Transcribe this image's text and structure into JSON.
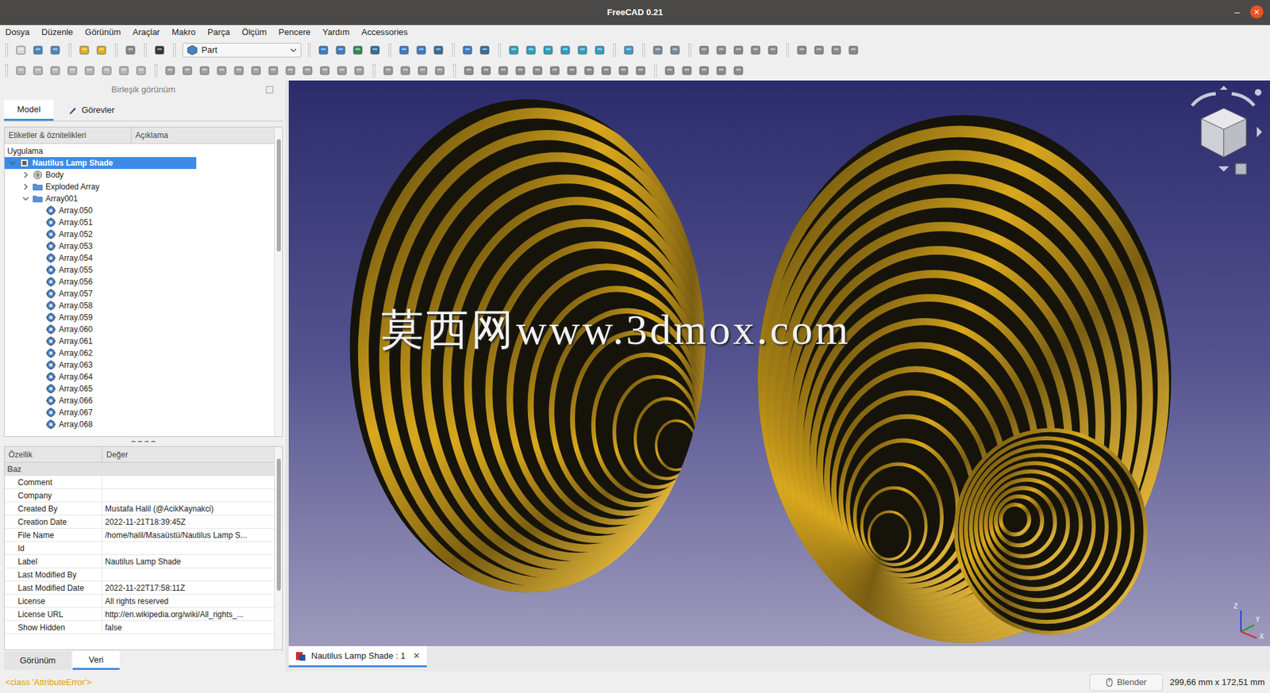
{
  "window": {
    "title": "FreeCAD 0.21",
    "minimize": "–",
    "close": "×"
  },
  "menu": [
    "Dosya",
    "Düzenle",
    "Görünüm",
    "Araçlar",
    "Makro",
    "Parça",
    "Ölçüm",
    "Pencere",
    "Yardım",
    "Accessories"
  ],
  "workbench": {
    "label": "Part"
  },
  "combo_view": {
    "title": "Birleşik görünüm",
    "tabs": [
      {
        "label": "Model",
        "selected": true
      },
      {
        "label": "Görevler",
        "selected": false
      }
    ]
  },
  "tree": {
    "columns": [
      "Etiketler & öznitelikleri",
      "Açıklama"
    ],
    "root": "Uygulama",
    "items": [
      {
        "label": "Nautilus Lamp Shade",
        "kind": "document",
        "depth": 0,
        "has_children": true,
        "expanded": true,
        "selected": true
      },
      {
        "label": "Body",
        "kind": "body",
        "depth": 1,
        "has_children": true,
        "expanded": false,
        "selected": false
      },
      {
        "label": "Exploded Array",
        "kind": "folder",
        "depth": 1,
        "has_children": true,
        "expanded": false,
        "selected": false
      },
      {
        "label": "Array001",
        "kind": "folder",
        "depth": 1,
        "has_children": true,
        "expanded": true,
        "selected": false
      },
      {
        "label": "Array.050",
        "kind": "array",
        "depth": 2,
        "has_children": false,
        "expanded": false,
        "selected": false
      },
      {
        "label": "Array.051",
        "kind": "array",
        "depth": 2,
        "has_children": false,
        "expanded": false,
        "selected": false
      },
      {
        "label": "Array.052",
        "kind": "array",
        "depth": 2,
        "has_children": false,
        "expanded": false,
        "selected": false
      },
      {
        "label": "Array.053",
        "kind": "array",
        "depth": 2,
        "has_children": false,
        "expanded": false,
        "selected": false
      },
      {
        "label": "Array.054",
        "kind": "array",
        "depth": 2,
        "has_children": false,
        "expanded": false,
        "selected": false
      },
      {
        "label": "Array.055",
        "kind": "array",
        "depth": 2,
        "has_children": false,
        "expanded": false,
        "selected": false
      },
      {
        "label": "Array.056",
        "kind": "array",
        "depth": 2,
        "has_children": false,
        "expanded": false,
        "selected": false
      },
      {
        "label": "Array.057",
        "kind": "array",
        "depth": 2,
        "has_children": false,
        "expanded": false,
        "selected": false
      },
      {
        "label": "Array.058",
        "kind": "array",
        "depth": 2,
        "has_children": false,
        "expanded": false,
        "selected": false
      },
      {
        "label": "Array.059",
        "kind": "array",
        "depth": 2,
        "has_children": false,
        "expanded": false,
        "selected": false
      },
      {
        "label": "Array.060",
        "kind": "array",
        "depth": 2,
        "has_children": false,
        "expanded": false,
        "selected": false
      },
      {
        "label": "Array.061",
        "kind": "array",
        "depth": 2,
        "has_children": false,
        "expanded": false,
        "selected": false
      },
      {
        "label": "Array.062",
        "kind": "array",
        "depth": 2,
        "has_children": false,
        "expanded": false,
        "selected": false
      },
      {
        "label": "Array.063",
        "kind": "array",
        "depth": 2,
        "has_children": false,
        "expanded": false,
        "selected": false
      },
      {
        "label": "Array.064",
        "kind": "array",
        "depth": 2,
        "has_children": false,
        "expanded": false,
        "selected": false
      },
      {
        "label": "Array.065",
        "kind": "array",
        "depth": 2,
        "has_children": false,
        "expanded": false,
        "selected": false
      },
      {
        "label": "Array.066",
        "kind": "array",
        "depth": 2,
        "has_children": false,
        "expanded": false,
        "selected": false
      },
      {
        "label": "Array.067",
        "kind": "array",
        "depth": 2,
        "has_children": false,
        "expanded": false,
        "selected": false
      },
      {
        "label": "Array.068",
        "kind": "array",
        "depth": 2,
        "has_children": false,
        "expanded": false,
        "selected": false
      }
    ]
  },
  "properties": {
    "columns": [
      "Özellik",
      "Değer"
    ],
    "group": "Baz",
    "rows": [
      {
        "name": "Comment",
        "value": ""
      },
      {
        "name": "Company",
        "value": ""
      },
      {
        "name": "Created By",
        "value": "Mustafa Halil (@AcikKaynakci)"
      },
      {
        "name": "Creation Date",
        "value": "2022-11-21T18:39:45Z"
      },
      {
        "name": "File Name",
        "value": "/home/halil/Masaüstü/Nautilus Lamp S..."
      },
      {
        "name": "Id",
        "value": ""
      },
      {
        "name": "Label",
        "value": "Nautilus Lamp Shade"
      },
      {
        "name": "Last Modified By",
        "value": ""
      },
      {
        "name": "Last Modified Date",
        "value": "2022-11-22T17:58:11Z"
      },
      {
        "name": "License",
        "value": "All rights reserved"
      },
      {
        "name": "License URL",
        "value": "http://en.wikipedia.org/wiki/All_rights_..."
      },
      {
        "name": "Show Hidden",
        "value": "false"
      }
    ]
  },
  "bottom_tabs": [
    {
      "label": "Görünüm",
      "selected": false
    },
    {
      "label": "Veri",
      "selected": true
    }
  ],
  "viewport": {
    "watermark": "莫西网www.3dmox.com",
    "axes": [
      "Z",
      "Y",
      "X"
    ]
  },
  "document_tab": {
    "label": "Nautilus Lamp Shade : 1",
    "close": "✕",
    "selected": true
  },
  "status_bar": {
    "message": "<class 'AttributeError'>",
    "nav_style": "Blender",
    "dimensions": "299,66 mm x 172,51 mm"
  }
}
